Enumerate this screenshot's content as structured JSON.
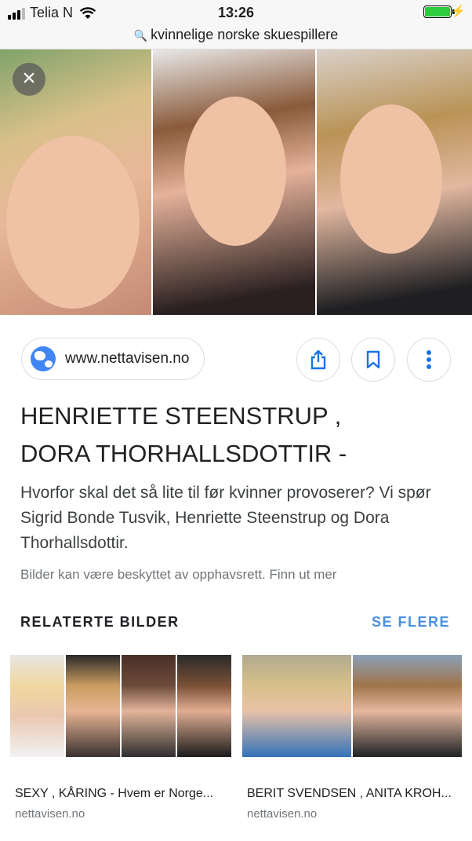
{
  "status_bar": {
    "carrier": "Telia N",
    "time": "13:26",
    "battery_percent": 100
  },
  "browser": {
    "search_query": "kvinnelige norske skuespillere"
  },
  "colors": {
    "link_blue": "#4a90e2",
    "text_primary": "#202124",
    "text_secondary": "#70757a",
    "globe_blue": "#4285f4"
  },
  "result": {
    "site": "www.nettavisen.no",
    "title_line1": "HENRIETTE STEENSTRUP ,",
    "title_line2": "DORA THORHALLSDOTTIR -",
    "description": "Hvorfor skal det så lite til før kvinner provoserer? Vi spør Sigrid Bonde Tusvik, Henriette Steenstrup og Dora Thorhallsdottir.",
    "copyright_notice": "Bilder kan være beskyttet av opphavsrett. Finn ut mer"
  },
  "related": {
    "heading": "RELATERTE BILDER",
    "see_more": "SE FLERE",
    "items": [
      {
        "caption": "SEXY , KÅRING - Hvem er Norge...",
        "domain": "nettavisen.no"
      },
      {
        "caption": "BERIT SVENDSEN , ANITA KROH...",
        "domain": "nettavisen.no"
      }
    ]
  },
  "icons": {
    "close": "close-icon",
    "share": "share-icon",
    "bookmark": "bookmark-icon",
    "more": "more-vertical-icon",
    "globe": "globe-icon",
    "search": "search-icon"
  }
}
